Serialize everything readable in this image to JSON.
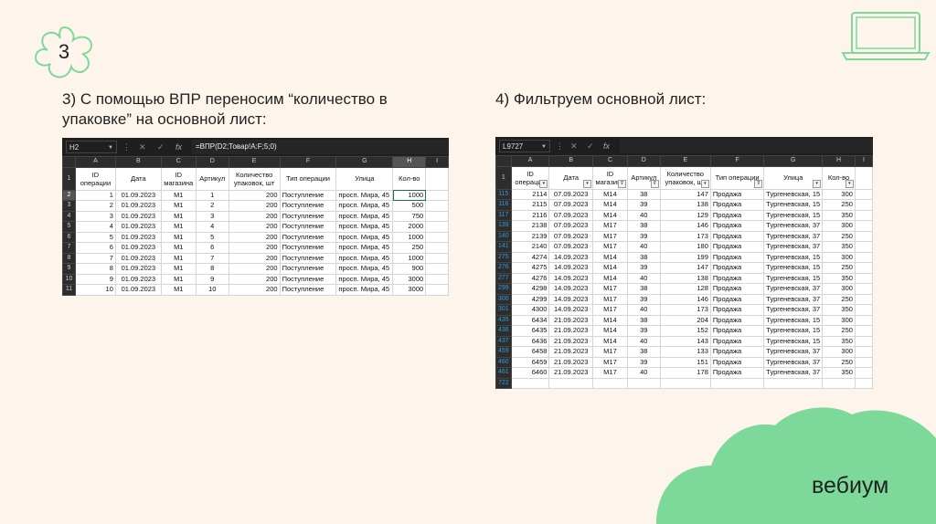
{
  "slide": {
    "number": "3",
    "heading_left": "3) С помощью ВПР переносим “количество в упаковке” на основной лист:",
    "heading_right": "4) Фильтруем основной лист:",
    "brand": "вебиум",
    "accent_color": "#7dd99a"
  },
  "left_sheet": {
    "name_box": "H2",
    "formula": "=ВПР(D2;Товар!A:F;5;0)",
    "formula_icons": [
      "more-icon",
      "cancel-icon",
      "confirm-icon",
      "fx-icon"
    ],
    "col_letters": [
      "A",
      "B",
      "C",
      "D",
      "E",
      "F",
      "G",
      "H",
      "I"
    ],
    "headers": [
      "ID операции",
      "Дата",
      "ID магазина",
      "Артикул",
      "Количество упаковок, шт",
      "Тип операции",
      "Улица",
      "Кол-во",
      ""
    ],
    "header_row_num": "1",
    "rows": [
      {
        "n": "2",
        "cells": [
          "1",
          "01.09.2023",
          "M1",
          "1",
          "200",
          "Поступление",
          "просп. Мира, 45",
          "1000"
        ]
      },
      {
        "n": "3",
        "cells": [
          "2",
          "01.09.2023",
          "M1",
          "2",
          "200",
          "Поступление",
          "просп. Мира, 45",
          "500"
        ]
      },
      {
        "n": "4",
        "cells": [
          "3",
          "01.09.2023",
          "M1",
          "3",
          "200",
          "Поступление",
          "просп. Мира, 45",
          "750"
        ]
      },
      {
        "n": "5",
        "cells": [
          "4",
          "01.09.2023",
          "M1",
          "4",
          "200",
          "Поступление",
          "просп. Мира, 45",
          "2000"
        ]
      },
      {
        "n": "6",
        "cells": [
          "5",
          "01.09.2023",
          "M1",
          "5",
          "200",
          "Поступление",
          "просп. Мира, 45",
          "1000"
        ]
      },
      {
        "n": "7",
        "cells": [
          "6",
          "01.09.2023",
          "M1",
          "6",
          "200",
          "Поступление",
          "просп. Мира, 45",
          "250"
        ]
      },
      {
        "n": "8",
        "cells": [
          "7",
          "01.09.2023",
          "M1",
          "7",
          "200",
          "Поступление",
          "просп. Мира, 45",
          "1000"
        ]
      },
      {
        "n": "9",
        "cells": [
          "8",
          "01.09.2023",
          "M1",
          "8",
          "200",
          "Поступление",
          "просп. Мира, 45",
          "900"
        ]
      },
      {
        "n": "10",
        "cells": [
          "9",
          "01.09.2023",
          "M1",
          "9",
          "200",
          "Поступление",
          "просп. Мира, 45",
          "3000"
        ]
      },
      {
        "n": "11",
        "cells": [
          "10",
          "01.09.2023",
          "M1",
          "10",
          "200",
          "Поступление",
          "просп. Мира, 45",
          "3000"
        ]
      }
    ]
  },
  "right_sheet": {
    "name_box": "L9727",
    "formula": "",
    "formula_icons": [
      "more-icon",
      "cancel-icon",
      "confirm-icon",
      "fx-icon"
    ],
    "col_letters": [
      "A",
      "B",
      "C",
      "D",
      "E",
      "F",
      "G",
      "H",
      "I"
    ],
    "headers": [
      "ID операции",
      "Дата",
      "ID магазина",
      "Артикул",
      "Количество упаковок, шт",
      "Тип операции",
      "Улица",
      "Кол-во",
      ""
    ],
    "header_row_num": "1",
    "rows": [
      {
        "n": "115",
        "cells": [
          "2114",
          "07.09.2023",
          "M14",
          "38",
          "147",
          "Продажа",
          "Тургеневская, 15",
          "300"
        ]
      },
      {
        "n": "116",
        "cells": [
          "2115",
          "07.09.2023",
          "M14",
          "39",
          "138",
          "Продажа",
          "Тургеневская, 15",
          "250"
        ]
      },
      {
        "n": "117",
        "cells": [
          "2116",
          "07.09.2023",
          "M14",
          "40",
          "129",
          "Продажа",
          "Тургеневская, 15",
          "350"
        ]
      },
      {
        "n": "139",
        "cells": [
          "2138",
          "07.09.2023",
          "M17",
          "38",
          "146",
          "Продажа",
          "Тургеневская, 37",
          "300"
        ]
      },
      {
        "n": "140",
        "cells": [
          "2139",
          "07.09.2023",
          "M17",
          "39",
          "173",
          "Продажа",
          "Тургеневская, 37",
          "250"
        ]
      },
      {
        "n": "141",
        "cells": [
          "2140",
          "07.09.2023",
          "M17",
          "40",
          "180",
          "Продажа",
          "Тургеневская, 37",
          "350"
        ]
      },
      {
        "n": "275",
        "cells": [
          "4274",
          "14.09.2023",
          "M14",
          "38",
          "199",
          "Продажа",
          "Тургеневская, 15",
          "300"
        ]
      },
      {
        "n": "276",
        "cells": [
          "4275",
          "14.09.2023",
          "M14",
          "39",
          "147",
          "Продажа",
          "Тургеневская, 15",
          "250"
        ]
      },
      {
        "n": "277",
        "cells": [
          "4276",
          "14.09.2023",
          "M14",
          "40",
          "138",
          "Продажа",
          "Тургеневская, 15",
          "350"
        ]
      },
      {
        "n": "299",
        "cells": [
          "4298",
          "14.09.2023",
          "M17",
          "38",
          "128",
          "Продажа",
          "Тургеневская, 37",
          "300"
        ]
      },
      {
        "n": "300",
        "cells": [
          "4299",
          "14.09.2023",
          "M17",
          "39",
          "146",
          "Продажа",
          "Тургеневская, 37",
          "250"
        ]
      },
      {
        "n": "301",
        "cells": [
          "4300",
          "14.09.2023",
          "M17",
          "40",
          "173",
          "Продажа",
          "Тургеневская, 37",
          "350"
        ]
      },
      {
        "n": "435",
        "cells": [
          "6434",
          "21.09.2023",
          "M14",
          "38",
          "204",
          "Продажа",
          "Тургеневская, 15",
          "300"
        ]
      },
      {
        "n": "436",
        "cells": [
          "6435",
          "21.09.2023",
          "M14",
          "39",
          "152",
          "Продажа",
          "Тургеневская, 15",
          "250"
        ]
      },
      {
        "n": "437",
        "cells": [
          "6436",
          "21.09.2023",
          "M14",
          "40",
          "143",
          "Продажа",
          "Тургеневская, 15",
          "350"
        ]
      },
      {
        "n": "459",
        "cells": [
          "6458",
          "21.09.2023",
          "M17",
          "38",
          "133",
          "Продажа",
          "Тургеневская, 37",
          "300"
        ]
      },
      {
        "n": "460",
        "cells": [
          "6459",
          "21.09.2023",
          "M17",
          "39",
          "151",
          "Продажа",
          "Тургеневская, 37",
          "250"
        ]
      },
      {
        "n": "461",
        "cells": [
          "6460",
          "21.09.2023",
          "M17",
          "40",
          "178",
          "Продажа",
          "Тургеневская, 37",
          "350"
        ]
      },
      {
        "n": "722",
        "cells": [
          "",
          "",
          "",
          "",
          "",
          "",
          "",
          "",
          ""
        ]
      }
    ]
  }
}
